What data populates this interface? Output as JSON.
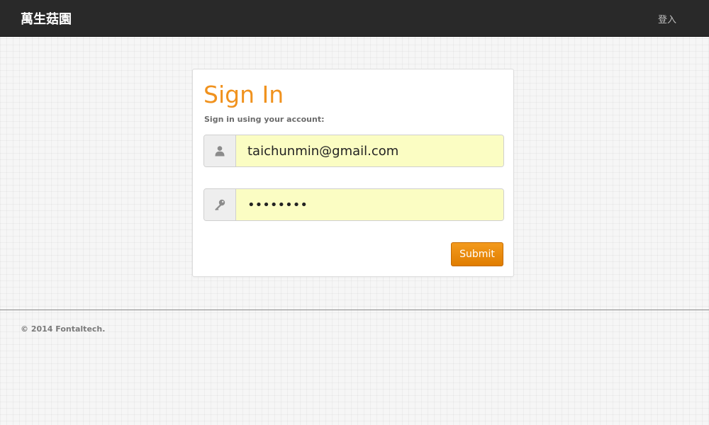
{
  "navbar": {
    "brand": "萬生菇園",
    "login_link": "登入"
  },
  "signin": {
    "title": "Sign In",
    "subtitle": "Sign in using your account:",
    "email": {
      "value": "taichunmin@gmail.com",
      "icon": "user-icon"
    },
    "password": {
      "value": "12345678",
      "icon": "key-icon"
    },
    "submit_label": "Submit"
  },
  "footer": {
    "copyright": "© 2014 Fontaltech."
  },
  "colors": {
    "navbar_bg": "#292929",
    "accent": "#f0921e",
    "field_autofill_bg": "#fbfdc3",
    "button_bg": "#e88a10"
  }
}
